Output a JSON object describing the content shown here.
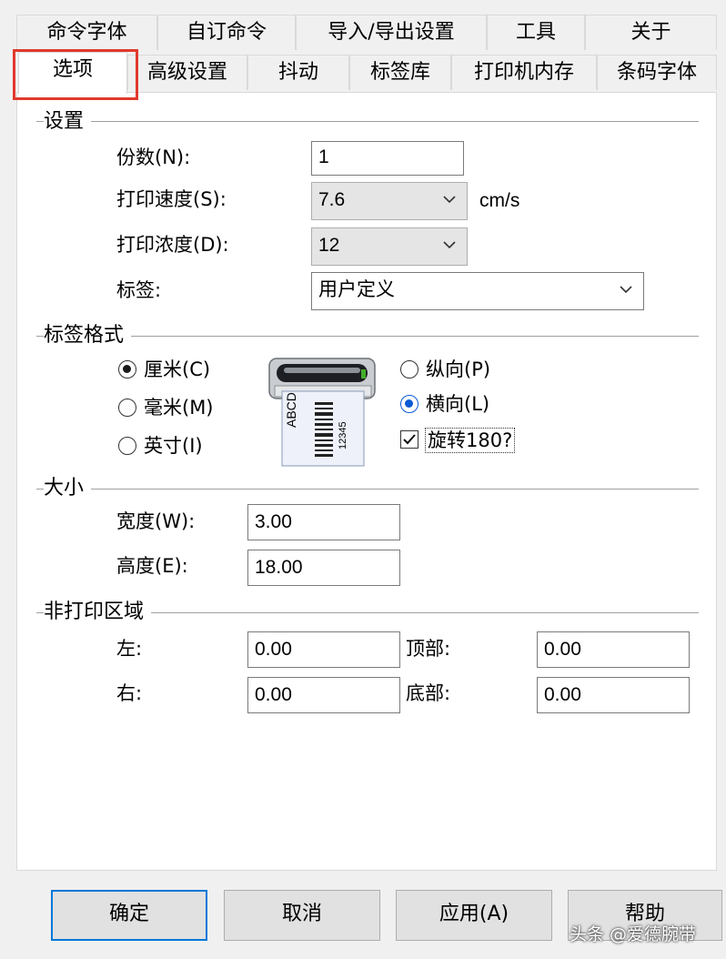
{
  "tabs_row1": [
    "命令字体",
    "自订命令",
    "导入/导出设置",
    "工具",
    "关于"
  ],
  "tabs_row2": [
    "选项",
    "高级设置",
    "抖动",
    "标签库",
    "打印机内存",
    "条码字体"
  ],
  "selected_tab": "选项",
  "settings": {
    "title": "设置",
    "copies_label": "份数(N):",
    "copies_value": "1",
    "speed_label": "打印速度(S):",
    "speed_value": "7.6",
    "speed_unit": "cm/s",
    "darkness_label": "打印浓度(D):",
    "darkness_value": "12",
    "label_label": "标签:",
    "label_value": "用户定义"
  },
  "label_format": {
    "title": "标签格式",
    "unit_cm": "厘米(C)",
    "unit_mm": "毫米(M)",
    "unit_inch": "英寸(I)",
    "portrait": "纵向(P)",
    "landscape": "横向(L)",
    "rotate": "旋转180?",
    "preview_text": "ABCD",
    "preview_code": "12345"
  },
  "size": {
    "title": "大小",
    "width_label": "宽度(W):",
    "width_value": "3.00",
    "height_label": "高度(E):",
    "height_value": "18.00"
  },
  "non_print": {
    "title": "非打印区域",
    "left_label": "左:",
    "left_value": "0.00",
    "right_label": "右:",
    "right_value": "0.00",
    "top_label": "顶部:",
    "top_value": "0.00",
    "bottom_label": "底部:",
    "bottom_value": "0.00"
  },
  "buttons": {
    "ok": "确定",
    "cancel": "取消",
    "apply": "应用(A)",
    "help": "帮助"
  },
  "watermark": "头条 @爱德腕带",
  "colors": {
    "highlight": "#e03a2c",
    "accent": "#0078d7"
  }
}
